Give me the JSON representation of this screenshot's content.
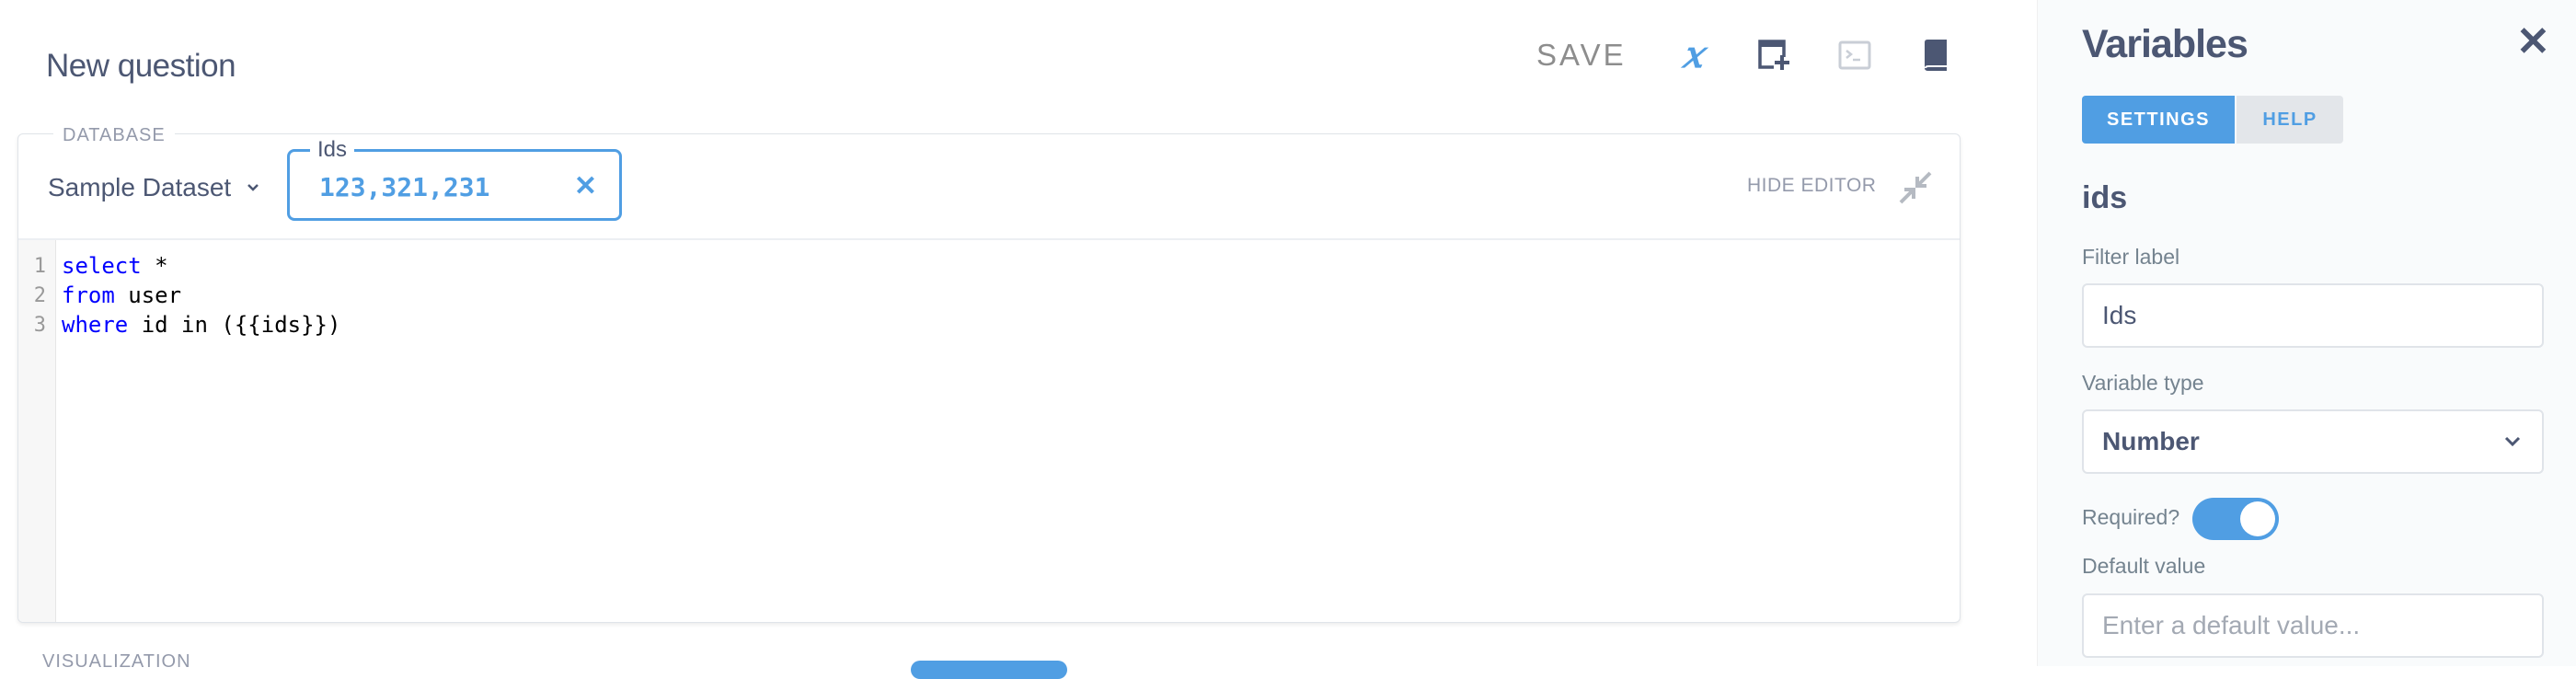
{
  "header": {
    "title": "New question",
    "save_label": "SAVE",
    "variables_icon_glyph": "𝑥",
    "icons": [
      "variables-x-icon",
      "add-snippet-icon",
      "console-icon",
      "book-icon"
    ]
  },
  "editor": {
    "database_legend": "DATABASE",
    "database_value": "Sample Dataset",
    "parameter": {
      "label": "Ids",
      "value": "123,321,231",
      "clear_glyph": "✕"
    },
    "hide_editor_label": "HIDE EDITOR",
    "lines": [
      {
        "number": "1",
        "keyword": "select",
        "rest": " *"
      },
      {
        "number": "2",
        "keyword": "from",
        "rest": " user"
      },
      {
        "number": "3",
        "keyword": "where",
        "rest": " id in ({{ids}})"
      }
    ]
  },
  "visualization": {
    "label": "VISUALIZATION"
  },
  "sidebar": {
    "title": "Variables",
    "close_glyph": "✕",
    "tabs": [
      {
        "label": "SETTINGS",
        "active": true
      },
      {
        "label": "HELP",
        "active": false
      }
    ],
    "variable_name": "ids",
    "filter_label_caption": "Filter label",
    "filter_label_value": "Ids",
    "variable_type_caption": "Variable type",
    "variable_type_value": "Number",
    "required_caption": "Required?",
    "required_on": true,
    "default_value_caption": "Default value",
    "default_value_placeholder": "Enter a default value..."
  },
  "colors": {
    "brand": "#509ee3",
    "text": "#4c5773",
    "muted": "#949aab"
  }
}
